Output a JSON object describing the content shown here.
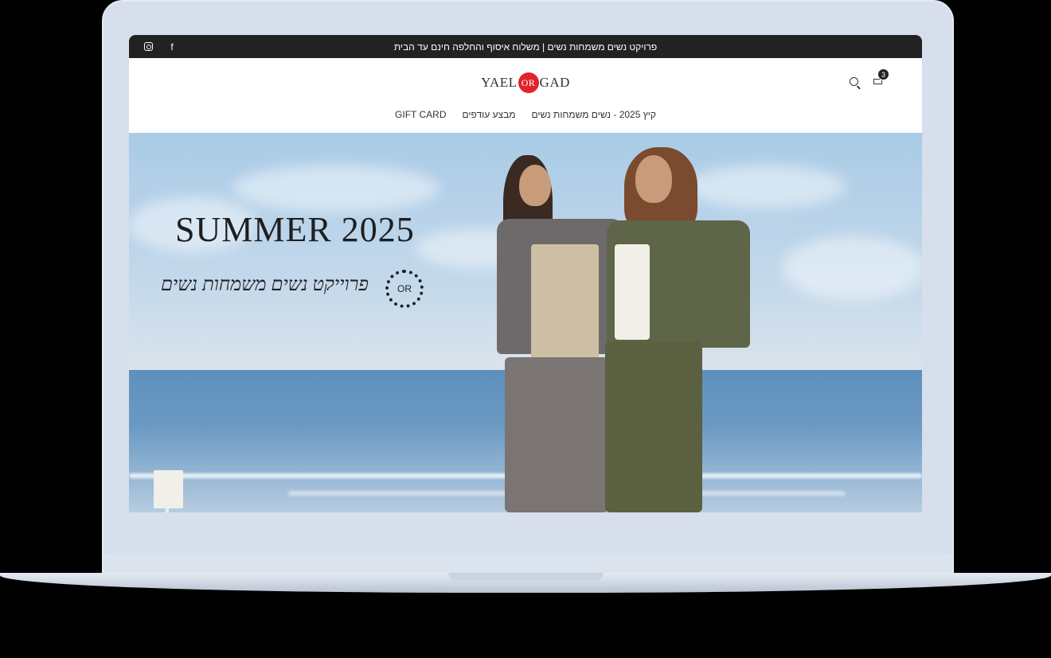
{
  "announcement": "פרויקט נשים משמחות נשים | משלוח איסוף והחלפה חינם עד הבית",
  "social": {
    "facebook_icon": "f",
    "instagram_icon": "instagram"
  },
  "logo": {
    "left": "YAEL",
    "center": "OR",
    "right": "GAD"
  },
  "cart": {
    "count": "3"
  },
  "nav": {
    "items": [
      "קיץ 2025 - נשים משמחות נשים",
      "מבצע עודפים",
      "GIFT CARD"
    ]
  },
  "hero": {
    "title": "SUMMER 2025",
    "subtitle": "פרוייקט נשים משמחות נשים",
    "badge": "OR"
  },
  "colors": {
    "accent": "#e0242b",
    "topbar": "#222222"
  }
}
